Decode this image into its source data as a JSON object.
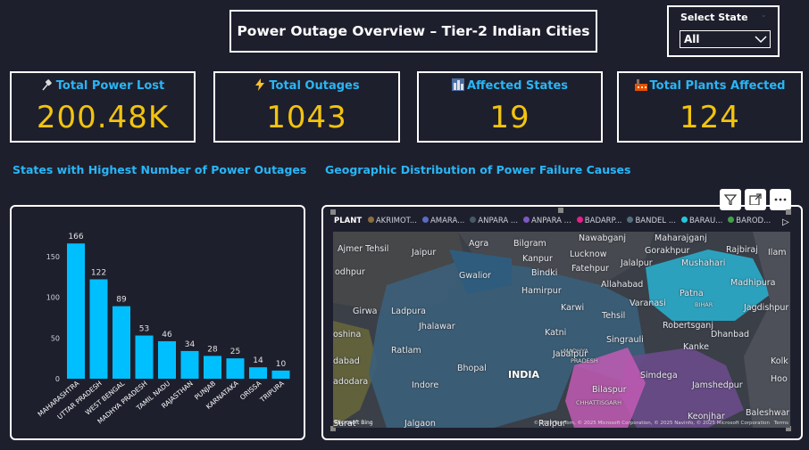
{
  "header": {
    "title": "Power Outage Overview – Tier-2 Indian Cities"
  },
  "slicer": {
    "label": "Select State",
    "value": "All"
  },
  "kpis": [
    {
      "label": "Total Power Lost",
      "value": "200.48K",
      "icon": "plug-icon"
    },
    {
      "label": "Total Outages",
      "value": "1043",
      "icon": "lightning-icon"
    },
    {
      "label": "Affected States",
      "value": "19",
      "icon": "city-icon"
    },
    {
      "label": "Total Plants Affected",
      "value": "124",
      "icon": "factory-icon"
    }
  ],
  "sections": {
    "bar_title": "States with Highest Number of Power Outages",
    "map_title": "Geographic Distribution of Power Failure Causes"
  },
  "colors": {
    "accent": "#29b6f6",
    "kpi_value": "#f2c40f",
    "bar": "#00bfff",
    "background": "#1e1f2d"
  },
  "chart_data": [
    {
      "type": "bar",
      "categories": [
        "MAHARASHTRA",
        "UTTAR PRADESH",
        "WEST BENGAL",
        "MADHYA PRADESH",
        "TAMIL NADU",
        "RAJASTHAN",
        "PUNJAB",
        "KARNATAKA",
        "ORISSA",
        "TRIPURA"
      ],
      "values": [
        166,
        122,
        89,
        53,
        46,
        34,
        28,
        25,
        14,
        10
      ],
      "yticks": [
        0,
        50,
        100,
        150
      ],
      "ylim": [
        0,
        175
      ],
      "data_labels": true,
      "grid": false
    }
  ],
  "map": {
    "legend_title": "PLANT",
    "legend": [
      {
        "label": "AKRIMOT...",
        "color": "#8d6e3a"
      },
      {
        "label": "AMARA...",
        "color": "#5c6bc0"
      },
      {
        "label": "ANPARA ...",
        "color": "#455a64"
      },
      {
        "label": "ANPARA ...",
        "color": "#7e57c2"
      },
      {
        "label": "BADARP...",
        "color": "#e91e8c"
      },
      {
        "label": "BANDEL ...",
        "color": "#546e7a"
      },
      {
        "label": "BARAU...",
        "color": "#26c6da"
      },
      {
        "label": "BAROD...",
        "color": "#43a047"
      }
    ],
    "places": [
      "Ajmer Tehsil",
      "Jaipur",
      "Agra",
      "Bilgram",
      "Nawabganj",
      "Maharajganj",
      "Rajbiraj",
      "Ilam",
      "odhpur",
      "Kanpur",
      "Lucknow",
      "Gorakhpur",
      "Mushahari",
      "Gwalior",
      "Bindki",
      "Fatehpur",
      "Jalalpur",
      "Madhipura",
      "Hamirpur",
      "Allahabad",
      "Patna",
      "Girwa",
      "Ladpura",
      "Karwi",
      "Varanasi",
      "Jagdishpur",
      "Tehsil",
      "BIHAR",
      "Jhalawar",
      "Robertsganj",
      "oshina",
      "Katni",
      "Singrauli",
      "Kanke",
      "Dhanbad",
      "Ratlam",
      "MADHYA",
      "PRADESH",
      "dabad",
      "Bhopal",
      "Jabalpur",
      "Kolk",
      "Indore",
      "INDIA",
      "Simdega",
      "Jamshedpur",
      "Hoo",
      "adodara",
      "Bilaspur",
      "CHHATTISGARH",
      "Keonjhar",
      "Baleshwar",
      "Surat",
      "Jalgaon",
      "Raipur"
    ],
    "attribution": "© 2025 TomTom, © 2025 Microsoft Corporation, © 2025 Navinfo, © 2025 Microsoft Corporation",
    "terms": "Terms",
    "brand": "Microsoft Bing"
  }
}
